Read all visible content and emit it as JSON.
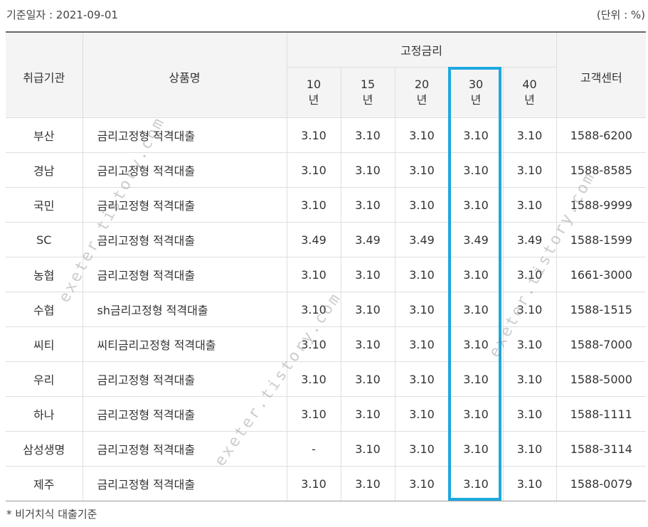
{
  "header": {
    "base_date": "기준일자 : 2021-09-01",
    "unit": "(단위 : %)"
  },
  "table": {
    "col_bank": "취급기관",
    "col_product": "상품명",
    "col_group": "고정금리",
    "terms": [
      {
        "num": "10",
        "unit": "년"
      },
      {
        "num": "15",
        "unit": "년"
      },
      {
        "num": "20",
        "unit": "년"
      },
      {
        "num": "30",
        "unit": "년"
      },
      {
        "num": "40",
        "unit": "년"
      }
    ],
    "col_cc": "고객센터",
    "rows": [
      {
        "bank": "부산",
        "product": "금리고정형 적격대출",
        "r10": "3.10",
        "r15": "3.10",
        "r20": "3.10",
        "r30": "3.10",
        "r40": "3.10",
        "phone": "1588-6200"
      },
      {
        "bank": "경남",
        "product": "금리고정형 적격대출",
        "r10": "3.10",
        "r15": "3.10",
        "r20": "3.10",
        "r30": "3.10",
        "r40": "3.10",
        "phone": "1588-8585"
      },
      {
        "bank": "국민",
        "product": "금리고정형 적격대출",
        "r10": "3.10",
        "r15": "3.10",
        "r20": "3.10",
        "r30": "3.10",
        "r40": "3.10",
        "phone": "1588-9999"
      },
      {
        "bank": "SC",
        "product": "금리고정형 적격대출",
        "r10": "3.49",
        "r15": "3.49",
        "r20": "3.49",
        "r30": "3.49",
        "r40": "3.49",
        "phone": "1588-1599"
      },
      {
        "bank": "농협",
        "product": "금리고정형 적격대출",
        "r10": "3.10",
        "r15": "3.10",
        "r20": "3.10",
        "r30": "3.10",
        "r40": "3.10",
        "phone": "1661-3000"
      },
      {
        "bank": "수협",
        "product": "sh금리고정형 적격대출",
        "r10": "3.10",
        "r15": "3.10",
        "r20": "3.10",
        "r30": "3.10",
        "r40": "3.10",
        "phone": "1588-1515"
      },
      {
        "bank": "씨티",
        "product": "씨티금리고정형 적격대출",
        "r10": "3.10",
        "r15": "3.10",
        "r20": "3.10",
        "r30": "3.10",
        "r40": "3.10",
        "phone": "1588-7000"
      },
      {
        "bank": "우리",
        "product": "금리고정형 적격대출",
        "r10": "3.10",
        "r15": "3.10",
        "r20": "3.10",
        "r30": "3.10",
        "r40": "3.10",
        "phone": "1588-5000"
      },
      {
        "bank": "하나",
        "product": "금리고정형 적격대출",
        "r10": "3.10",
        "r15": "3.10",
        "r20": "3.10",
        "r30": "3.10",
        "r40": "3.10",
        "phone": "1588-1111"
      },
      {
        "bank": "삼성생명",
        "product": "금리고정형 적격대출",
        "r10": "-",
        "r15": "3.10",
        "r20": "3.10",
        "r30": "3.10",
        "r40": "3.10",
        "phone": "1588-3114"
      },
      {
        "bank": "제주",
        "product": "금리고정형 적격대출",
        "r10": "3.10",
        "r15": "3.10",
        "r20": "3.10",
        "r30": "3.10",
        "r40": "3.10",
        "phone": "1588-0079"
      }
    ]
  },
  "footnote": "* 비거치식 대출기준",
  "watermark": "exeter.tistory.com",
  "colors": {
    "highlight": "#1da8e0",
    "header_bg": "#f4f4f4"
  }
}
